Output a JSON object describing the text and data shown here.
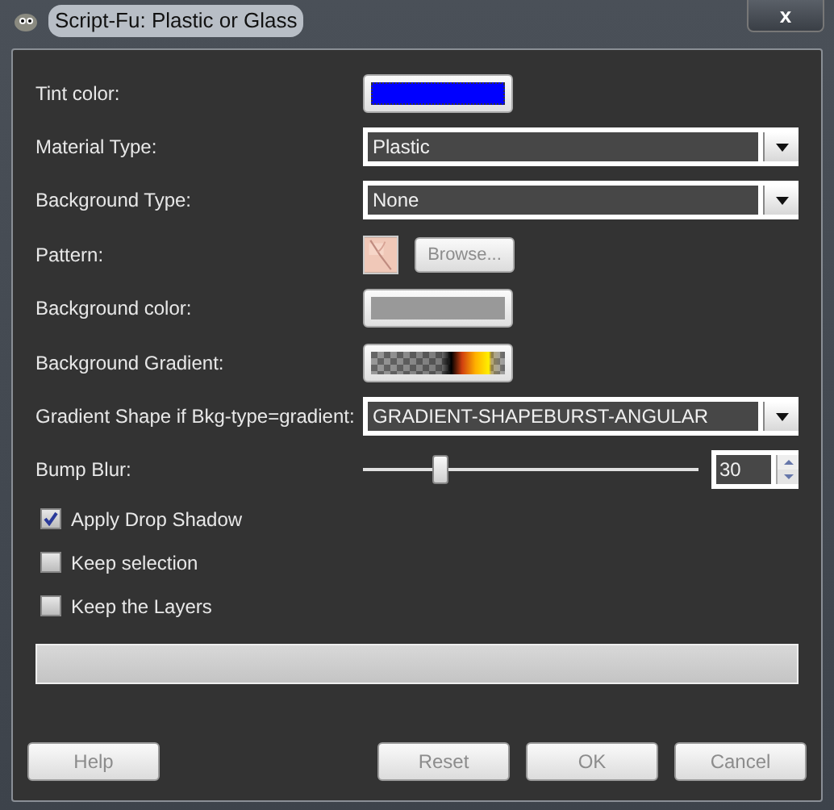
{
  "window": {
    "title": "Script-Fu: Plastic or Glass",
    "close_label": "x"
  },
  "rows": [
    {
      "kind": "color",
      "label": "Tint color:",
      "color": "#0000ff",
      "focused": true
    },
    {
      "kind": "combo",
      "label": "Material Type:",
      "value": "Plastic"
    },
    {
      "kind": "combo",
      "label": "Background Type:",
      "value": "None"
    },
    {
      "kind": "pattern",
      "label": "Pattern:",
      "button": "Browse...",
      "disabled": true
    },
    {
      "kind": "color",
      "label": "Background color:",
      "color": "#999999",
      "focused": false
    },
    {
      "kind": "gradient",
      "label": "Background Gradient:"
    },
    {
      "kind": "combo",
      "label": "Gradient Shape if Bkg-type=gradient:",
      "value": "GRADIENT-SHAPEBURST-ANGULAR"
    },
    {
      "kind": "slider",
      "label": "Bump Blur:",
      "level": 0.23,
      "value": "30"
    }
  ],
  "checkboxes": [
    {
      "label": "Apply Drop Shadow",
      "checked": true
    },
    {
      "label": "Keep selection",
      "checked": false
    },
    {
      "label": "Keep the Layers",
      "checked": false
    }
  ],
  "progress": {
    "level": 0
  },
  "buttons": [
    {
      "label": "Help",
      "disabled": true
    },
    {
      "label": "Reset",
      "disabled": true
    },
    {
      "label": "OK",
      "disabled": true
    },
    {
      "label": "Cancel",
      "disabled": true
    }
  ]
}
